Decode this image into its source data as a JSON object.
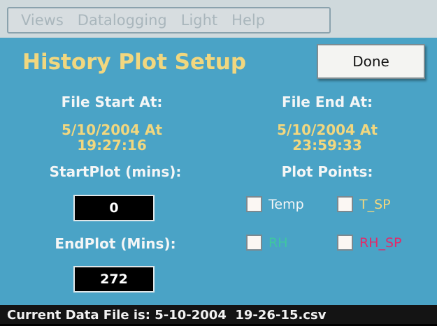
{
  "menu": {
    "items": [
      {
        "label": "Views"
      },
      {
        "label": "Datalogging"
      },
      {
        "label": "Light"
      },
      {
        "label": "Help"
      }
    ]
  },
  "title": "History Plot Setup",
  "done_label": "Done",
  "file_start": {
    "label": "File Start At:",
    "date_line": "5/10/2004 At",
    "time_line": "19:27:16"
  },
  "file_end": {
    "label": "File End At:",
    "date_line": "5/10/2004 At",
    "time_line": "23:59:33"
  },
  "start_plot": {
    "label": "StartPlot (mins):",
    "value": "0"
  },
  "end_plot": {
    "label": "EndPlot (Mins):",
    "value": "272"
  },
  "plot_points": {
    "label": "Plot Points:",
    "options": [
      {
        "label": "Temp",
        "checked": false,
        "color": "#f4f6f6"
      },
      {
        "label": "T_SP",
        "checked": false,
        "color": "#f1d77f"
      },
      {
        "label": "RH",
        "checked": false,
        "color": "#3ec7a0"
      },
      {
        "label": "RH_SP",
        "checked": false,
        "color": "#e22a6a"
      }
    ]
  },
  "status": "Current Data File is: 5-10-2004  19-26-15.csv"
}
